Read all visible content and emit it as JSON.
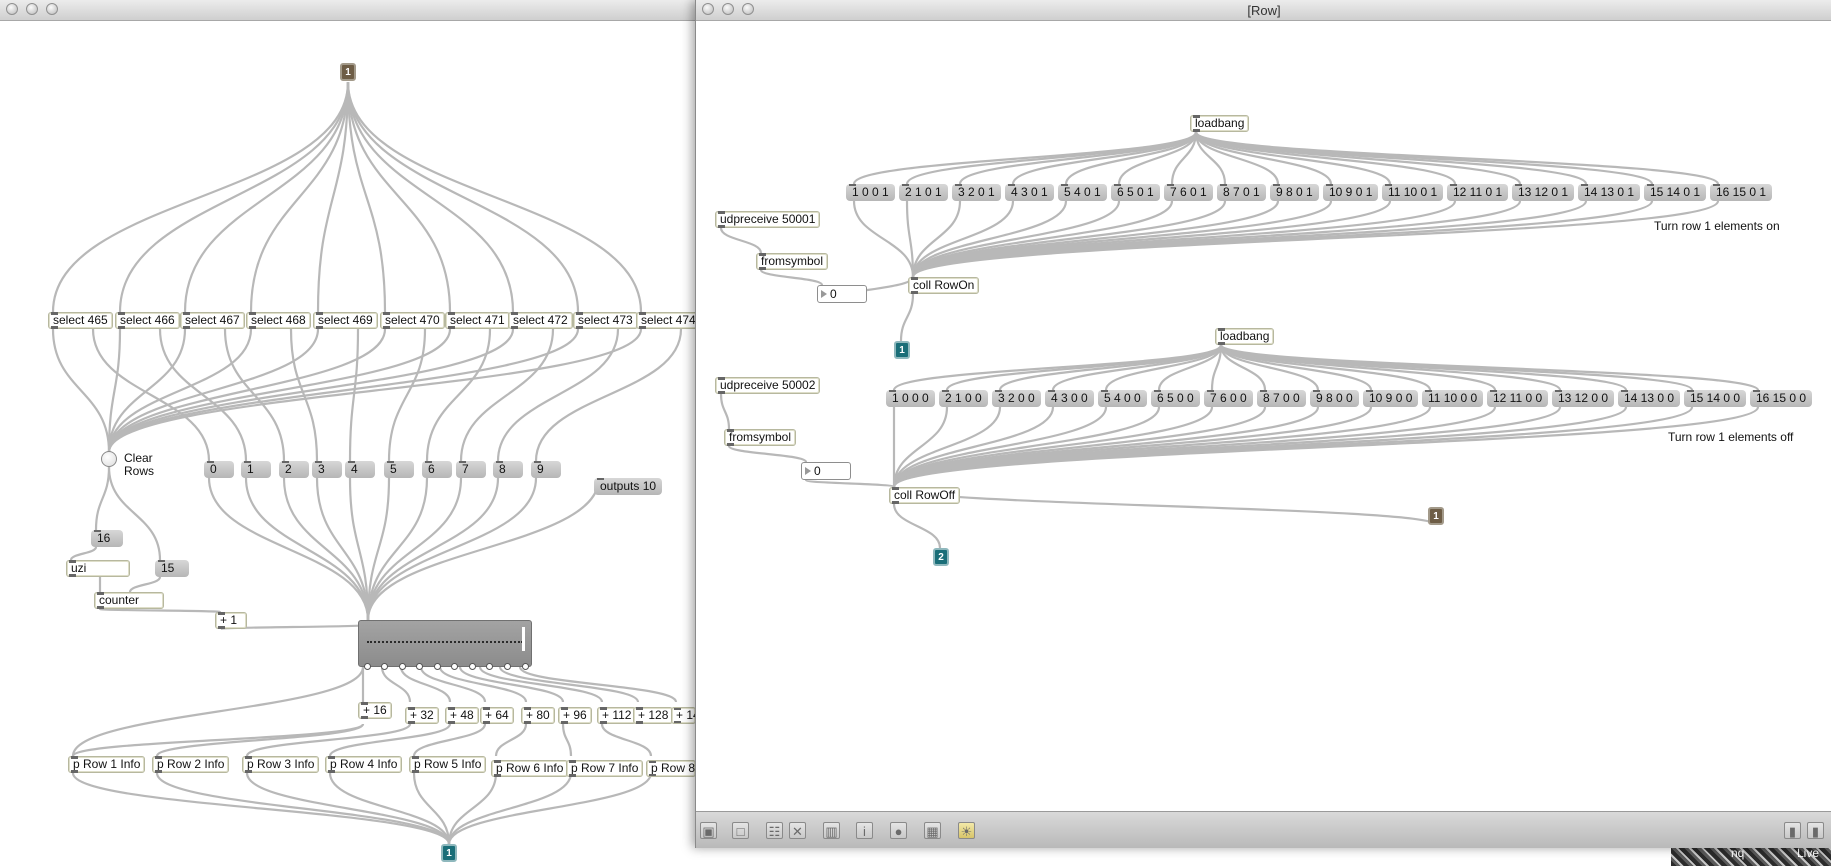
{
  "left_window": {
    "inlet_top": "1",
    "selects": [
      "select 465",
      "select 466",
      "select 467",
      "select 468",
      "select 469",
      "select 470",
      "select 471",
      "select 472",
      "select 473",
      "select 474"
    ],
    "clear_rows_label": "Clear\nRows",
    "index_messages": [
      "0",
      "1",
      "2",
      "3",
      "4",
      "5",
      "6",
      "7",
      "8",
      "9"
    ],
    "outputs_message": "outputs 10",
    "msg_16": "16",
    "msg_15": "15",
    "uzi": "uzi",
    "counter": "counter",
    "plus_1": "+ 1",
    "adders": [
      "+ 16",
      "+ 32",
      "+ 48",
      "+ 64",
      "+ 80",
      "+ 96",
      "+ 112",
      "+ 128",
      "+ 14"
    ],
    "row_info": [
      "p Row 1 Info",
      "p Row 2 Info",
      "p Row 3 Info",
      "p Row 4 Info",
      "p Row 5 Info",
      "p Row 6 Info",
      "p Row 7 Info",
      "p Row 8"
    ],
    "outlet_bottom": "1"
  },
  "right_window": {
    "title": "[Row]",
    "section_on": {
      "loadbang": "loadbang",
      "udpreceive": "udpreceive 50001",
      "fromsymbol": "fromsymbol",
      "number": "0",
      "coll": "coll RowOn",
      "outlet": "1",
      "comment": "Turn row 1 elements on",
      "messages": [
        "1 0 0 1",
        "2 1 0 1",
        "3 2 0 1",
        "4 3 0 1",
        "5 4 0 1",
        "6 5 0 1",
        "7 6 0 1",
        "8 7 0 1",
        "9 8 0 1",
        "10 9 0 1",
        "11 10 0 1",
        "12 11 0 1",
        "13 12 0 1",
        "14 13 0 1",
        "15 14 0 1",
        "16 15 0 1"
      ]
    },
    "section_off": {
      "loadbang": "loadbang",
      "udpreceive": "udpreceive 50002",
      "fromsymbol": "fromsymbol",
      "number": "0",
      "coll": "coll RowOff",
      "inlet": "1",
      "outlet": "2",
      "comment": "Turn row 1 elements off",
      "messages": [
        "1 0 0 0",
        "2 1 0 0",
        "3 2 0 0",
        "4 3 0 0",
        "5 4 0 0",
        "6 5 0 0",
        "7 6 0 0",
        "8 7 0 0",
        "9 8 0 0",
        "10 9 0 0",
        "11 10 0 0",
        "12 11 0 0",
        "13 12 0 0",
        "14 13 0 0",
        "15 14 0 0",
        "16 15 0 0"
      ]
    },
    "toolbar_icons": [
      "lock-icon",
      "presentation-icon",
      "patcher-icon",
      "delete-icon",
      "grid-icon",
      "info-icon",
      "inspector-icon",
      "snap-grid-icon",
      "bulb-icon"
    ]
  },
  "background_window": {
    "text_nq": "nq",
    "text_live": "Live"
  }
}
